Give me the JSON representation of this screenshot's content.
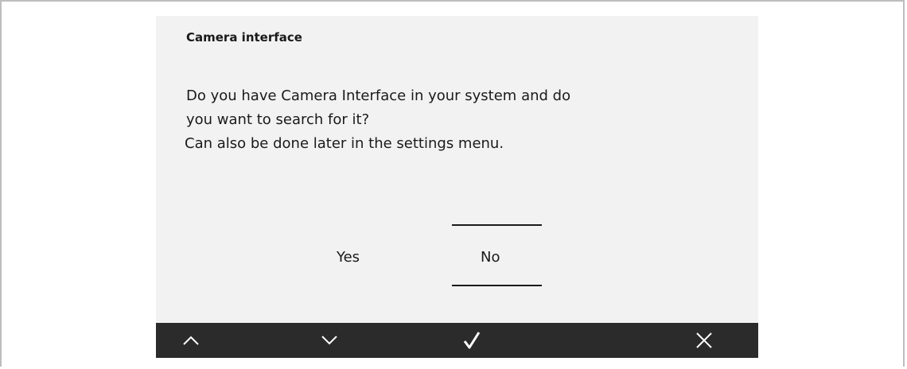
{
  "dialog": {
    "title": "Camera interface",
    "message_lines": [
      "Do you have Camera Interface in your system and do",
      "you want to search for it?",
      "Can also be done later in the settings menu."
    ]
  },
  "options": [
    {
      "label": "Yes",
      "selected": false
    },
    {
      "label": "No",
      "selected": true
    }
  ],
  "bottom_bar": {
    "buttons": [
      {
        "icon": "chevron-up-icon"
      },
      {
        "icon": "chevron-down-icon"
      },
      {
        "icon": "checkmark-icon"
      },
      {
        "icon": "close-icon"
      }
    ]
  },
  "colors": {
    "screen_bg": "#f2f2f2",
    "bar_bg": "#2b2b2b",
    "text": "#1a1a1a",
    "icon": "#ffffff",
    "frame_border": "#bdbdbd"
  }
}
